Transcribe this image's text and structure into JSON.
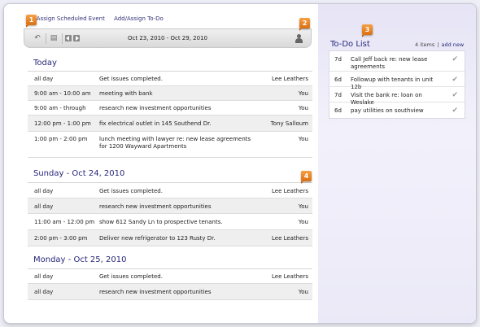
{
  "toolbar": {
    "link_schedule": "d/Assign Scheduled Event",
    "link_todo": "Add/Assign To-Do",
    "date_range": "Oct 23, 2010 - Oct 29, 2010"
  },
  "badges": [
    "1",
    "2",
    "3",
    "4"
  ],
  "schedule": [
    {
      "title": "Today",
      "rows": [
        {
          "time": "all day",
          "desc": "Get issues completed.",
          "who": "Lee Leathers"
        },
        {
          "time": "9:00 am - 10:00 am",
          "desc": "meeting with bank",
          "who": "You"
        },
        {
          "time": "9:00 am - through",
          "desc": "research new investment opportunities",
          "who": "You"
        },
        {
          "time": "12:00 pm - 1:00 pm",
          "desc": "fix electrical outlet in 145 Southend Dr.",
          "who": "Tony Salloum"
        },
        {
          "time": "1:00 pm - 2:00 pm",
          "desc": "lunch meeting with lawyer re: new lease agreements for 1200 Wayward Apartments",
          "who": "You"
        }
      ]
    },
    {
      "title": "Sunday - Oct 24, 2010",
      "rows": [
        {
          "time": "all day",
          "desc": "Get issues completed.",
          "who": "Lee Leathers"
        },
        {
          "time": "all day",
          "desc": "research new investment opportunities",
          "who": "You"
        },
        {
          "time": "11:00 am - 12:00 pm",
          "desc": "show 612 Sandy Ln to prospective tenants.",
          "who": "You"
        },
        {
          "time": "2:00 pm - 3:00 pm",
          "desc": "Deliver new refrigerator to 123 Rusty Dr.",
          "who": "Lee Leathers"
        }
      ]
    },
    {
      "title": "Monday - Oct 25, 2010",
      "rows": [
        {
          "time": "all day",
          "desc": "Get issues completed.",
          "who": "Lee Leathers"
        },
        {
          "time": "all day",
          "desc": "research new investment opportunities",
          "who": "You"
        }
      ]
    }
  ],
  "todo": {
    "title": "To-Do List",
    "count": "4 items",
    "separator": "|",
    "add_label": "add new",
    "items": [
      {
        "days": "7d",
        "text": "Call Jeff back re: new lease agreements"
      },
      {
        "days": "6d",
        "text": "Followup with tenants in unit 12b"
      },
      {
        "days": "7d",
        "text": "Visit the bank re: loan on Weslake"
      },
      {
        "days": "6d",
        "text": "pay utilities on southview"
      }
    ]
  },
  "colors": {
    "accent": "#27277a",
    "badge": "#e8831f"
  }
}
